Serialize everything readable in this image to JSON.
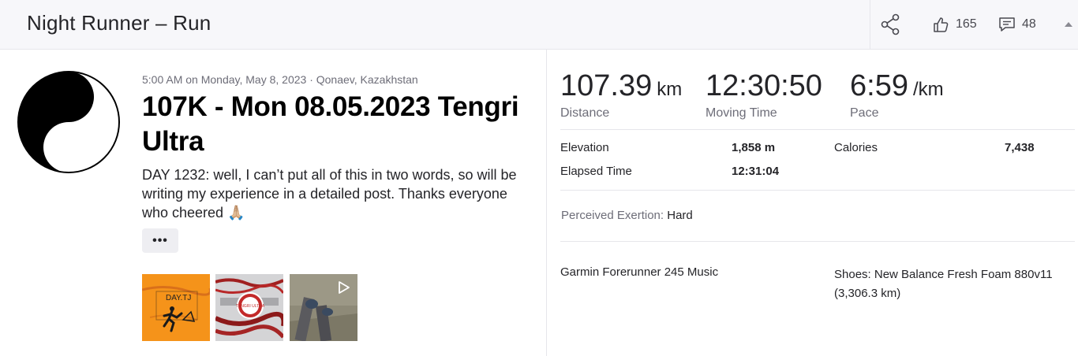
{
  "header": {
    "title": "Night Runner – Run",
    "kudos_count": "165",
    "comments_count": "48"
  },
  "activity": {
    "meta": "5:00 AM on Monday, May 8, 2023 · Qonaev, Kazakhstan",
    "title": "107K - Mon 08.05.2023 Tengri Ultra",
    "description": "DAY 1232: well, I can’t put all of this in two words, so will be writing my experience in a detailed post. Thanks everyone who cheered 🙏🏼",
    "more_label": "•••",
    "photos": [
      {
        "text": "DAY.TJ"
      },
      {
        "text": "TENGRI ULTRA"
      },
      {
        "text": ""
      }
    ]
  },
  "stats": {
    "distance": {
      "value": "107.39",
      "unit": "km",
      "label": "Distance"
    },
    "moving_time": {
      "value": "12:30:50",
      "label": "Moving Time"
    },
    "pace": {
      "value": "6:59",
      "unit": "/km",
      "label": "Pace"
    },
    "elevation": {
      "label": "Elevation",
      "value": "1,858 m"
    },
    "elapsed_time": {
      "label": "Elapsed Time",
      "value": "12:31:04"
    },
    "calories": {
      "label": "Calories",
      "value": "7,438"
    },
    "perceived_exertion": {
      "label": "Perceived Exertion:",
      "value": "Hard"
    }
  },
  "gear": {
    "device": "Garmin Forerunner 245 Music",
    "shoes": "Shoes: New Balance Fresh Foam 880v11 (3,306.3 km)"
  },
  "colors": {
    "header_bg": "#f7f7fa",
    "text_primary": "#242428",
    "text_secondary": "#6d6d78",
    "divider": "#e6e6eb"
  }
}
